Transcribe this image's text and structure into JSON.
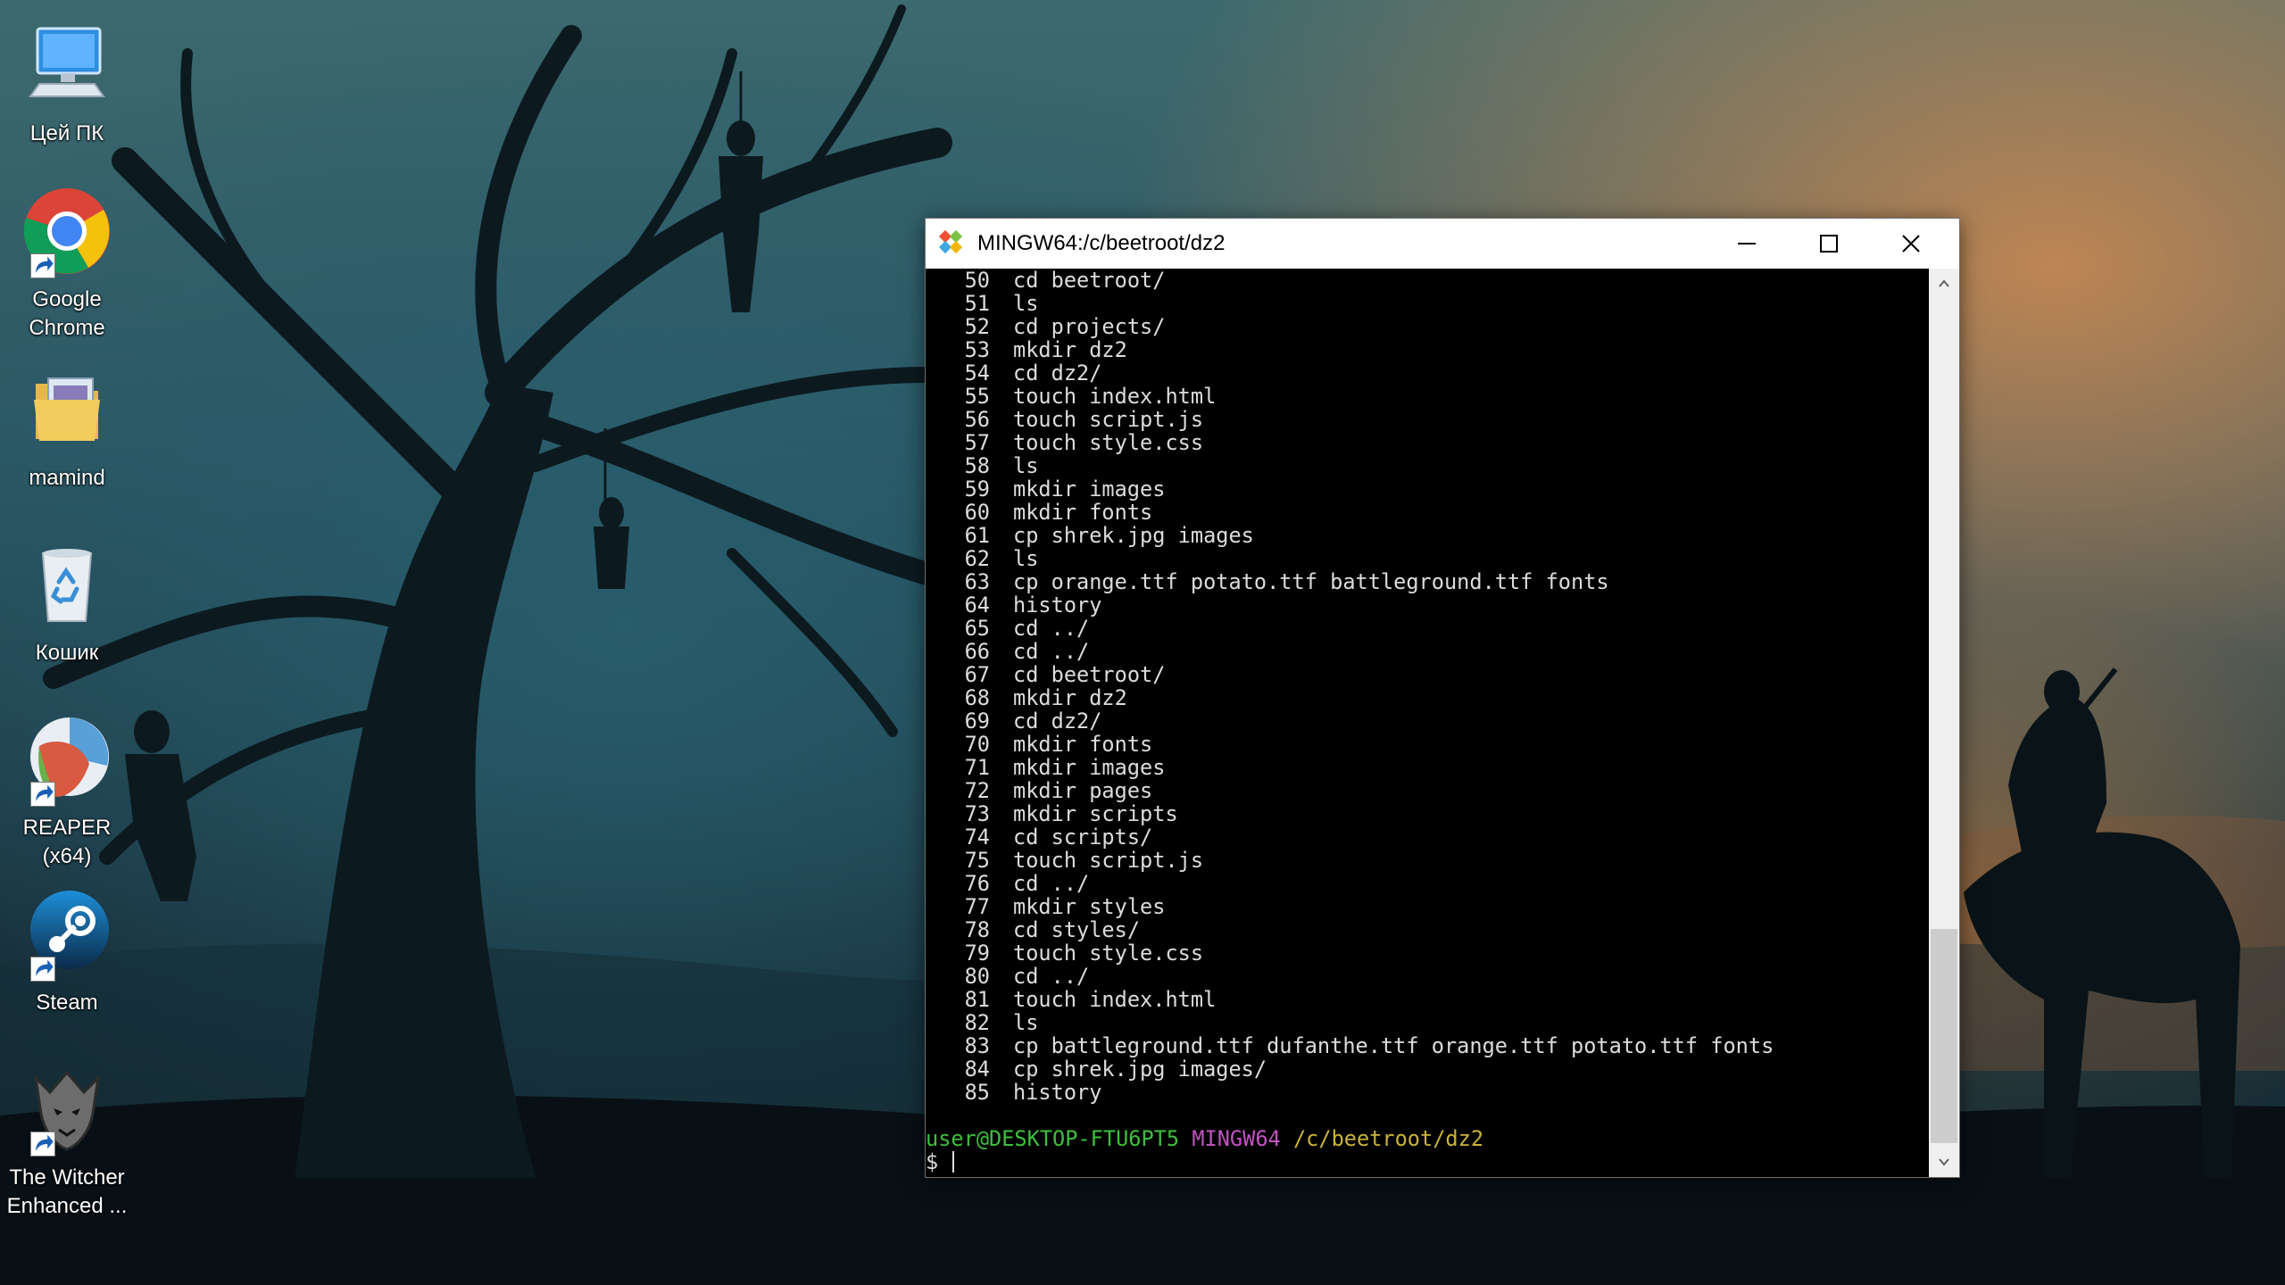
{
  "desktop": {
    "icons": [
      {
        "label": "Цей ПК",
        "icon": "computer-icon"
      },
      {
        "label": "Google\nChrome",
        "icon": "chrome-icon"
      },
      {
        "label": "mamind",
        "icon": "folder-icon"
      },
      {
        "label": "Кошик",
        "icon": "recycle-bin-icon"
      },
      {
        "label": "REAPER (x64)",
        "icon": "reaper-icon"
      },
      {
        "label": "Steam",
        "icon": "steam-icon"
      },
      {
        "label": "The Witcher\nEnhanced ...",
        "icon": "witcher-icon"
      }
    ]
  },
  "window": {
    "title": "MINGW64:/c/beetroot/dz2",
    "buttons": {
      "minimize": "minimize-icon",
      "maximize": "maximize-icon",
      "close": "close-icon"
    }
  },
  "terminal": {
    "history": [
      {
        "num": "50",
        "cmd": "cd beetroot/"
      },
      {
        "num": "51",
        "cmd": "ls"
      },
      {
        "num": "52",
        "cmd": "cd projects/"
      },
      {
        "num": "53",
        "cmd": "mkdir dz2"
      },
      {
        "num": "54",
        "cmd": "cd dz2/"
      },
      {
        "num": "55",
        "cmd": "touch index.html"
      },
      {
        "num": "56",
        "cmd": "touch script.js"
      },
      {
        "num": "57",
        "cmd": "touch style.css"
      },
      {
        "num": "58",
        "cmd": "ls"
      },
      {
        "num": "59",
        "cmd": "mkdir images"
      },
      {
        "num": "60",
        "cmd": "mkdir fonts"
      },
      {
        "num": "61",
        "cmd": "cp shrek.jpg images"
      },
      {
        "num": "62",
        "cmd": "ls"
      },
      {
        "num": "63",
        "cmd": "cp orange.ttf potato.ttf battleground.ttf fonts"
      },
      {
        "num": "64",
        "cmd": "history"
      },
      {
        "num": "65",
        "cmd": "cd ../"
      },
      {
        "num": "66",
        "cmd": "cd ../"
      },
      {
        "num": "67",
        "cmd": "cd beetroot/"
      },
      {
        "num": "68",
        "cmd": "mkdir dz2"
      },
      {
        "num": "69",
        "cmd": "cd dz2/"
      },
      {
        "num": "70",
        "cmd": "mkdir fonts"
      },
      {
        "num": "71",
        "cmd": "mkdir images"
      },
      {
        "num": "72",
        "cmd": "mkdir pages"
      },
      {
        "num": "73",
        "cmd": "mkdir scripts"
      },
      {
        "num": "74",
        "cmd": "cd scripts/"
      },
      {
        "num": "75",
        "cmd": "touch script.js"
      },
      {
        "num": "76",
        "cmd": "cd ../"
      },
      {
        "num": "77",
        "cmd": "mkdir styles"
      },
      {
        "num": "78",
        "cmd": "cd styles/"
      },
      {
        "num": "79",
        "cmd": "touch style.css"
      },
      {
        "num": "80",
        "cmd": "cd ../"
      },
      {
        "num": "81",
        "cmd": "touch index.html"
      },
      {
        "num": "82",
        "cmd": "ls"
      },
      {
        "num": "83",
        "cmd": "cp battleground.ttf dufanthe.ttf orange.ttf potato.ttf fonts"
      },
      {
        "num": "84",
        "cmd": "cp shrek.jpg images/"
      },
      {
        "num": "85",
        "cmd": "history"
      }
    ],
    "prompt": {
      "user_host": "user@DESKTOP-FTU6PT5",
      "shell": "MINGW64",
      "path": "/c/beetroot/dz2",
      "symbol": "$"
    },
    "colors": {
      "user": "#3fbf3f",
      "shell": "#c054c0",
      "path": "#c9b33a",
      "text": "#dcdcdc"
    }
  }
}
